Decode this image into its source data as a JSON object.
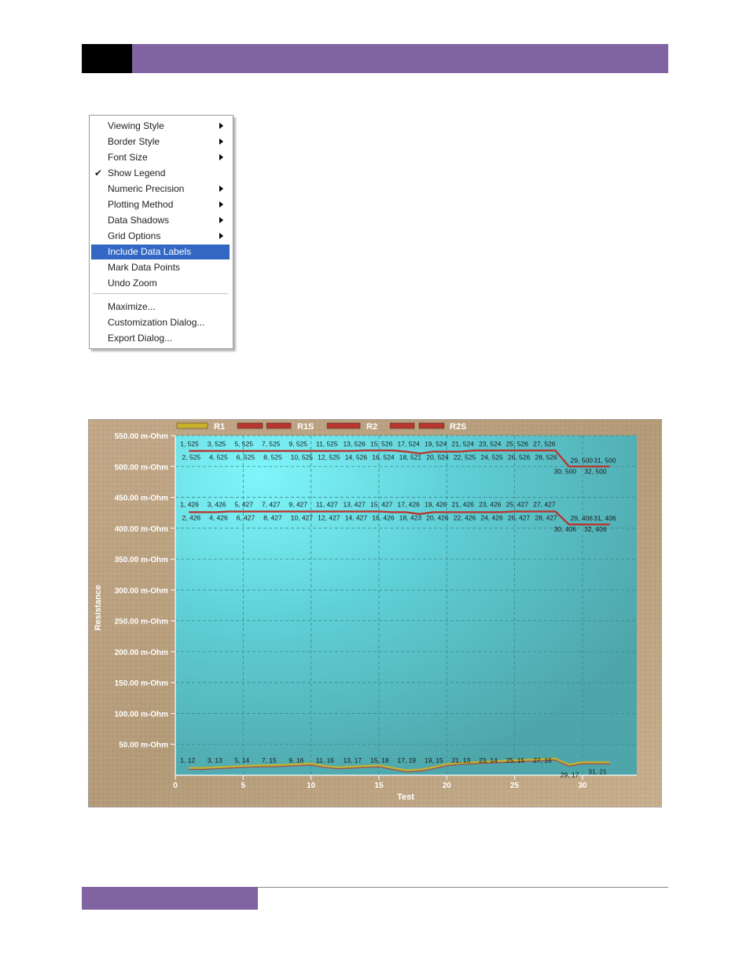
{
  "context_menu": {
    "items": [
      {
        "label": "Viewing Style",
        "submenu": true,
        "checked": false,
        "selected": false
      },
      {
        "label": "Border Style",
        "submenu": true,
        "checked": false,
        "selected": false
      },
      {
        "label": "Font Size",
        "submenu": true,
        "checked": false,
        "selected": false
      },
      {
        "label": "Show Legend",
        "submenu": false,
        "checked": true,
        "selected": false
      },
      {
        "label": "Numeric Precision",
        "submenu": true,
        "checked": false,
        "selected": false
      },
      {
        "label": "Plotting Method",
        "submenu": true,
        "checked": false,
        "selected": false
      },
      {
        "label": "Data Shadows",
        "submenu": true,
        "checked": false,
        "selected": false
      },
      {
        "label": "Grid Options",
        "submenu": true,
        "checked": false,
        "selected": false
      },
      {
        "label": "Include Data Labels",
        "submenu": false,
        "checked": false,
        "selected": true
      },
      {
        "label": "Mark Data Points",
        "submenu": false,
        "checked": false,
        "selected": false
      },
      {
        "label": "Undo Zoom",
        "submenu": false,
        "checked": false,
        "selected": false
      }
    ],
    "items2": [
      {
        "label": "Maximize..."
      },
      {
        "label": "Customization Dialog..."
      },
      {
        "label": "Export Dialog..."
      }
    ],
    "check_glyph": "✔"
  },
  "chart_data": {
    "type": "line",
    "xlabel": "Test",
    "ylabel": "Resistance",
    "xlim": [
      0,
      34
    ],
    "ylim": [
      0,
      550
    ],
    "xticks": [
      "0",
      "5",
      "10",
      "15",
      "20",
      "25",
      "30"
    ],
    "yticks": [
      "50.00 m-Ohm",
      "100.00 m-Ohm",
      "150.00 m-Ohm",
      "200.00 m-Ohm",
      "250.00 m-Ohm",
      "300.00 m-Ohm",
      "350.00 m-Ohm",
      "400.00 m-Ohm",
      "450.00 m-Ohm",
      "500.00 m-Ohm",
      "550.00 m-Ohm"
    ],
    "legend": [
      "R1",
      "R1S",
      "R2",
      "R2S"
    ],
    "colors": {
      "R1": "#c9b02a",
      "R1S": "#b9362e",
      "R2": "#b9362e",
      "R2S": "#b9362e",
      "low": "#c9b02a"
    },
    "series": [
      {
        "name": "R1S",
        "values": [
          525,
          525,
          525,
          525,
          525,
          525,
          525,
          525,
          525,
          525,
          525,
          525,
          525,
          526,
          526,
          526,
          524,
          521,
          524,
          524,
          524,
          526,
          526,
          526,
          526,
          526,
          526,
          526,
          500,
          500,
          500,
          500
        ]
      },
      {
        "name": "R2S",
        "values": [
          426,
          426,
          426,
          427,
          427,
          427,
          427,
          427,
          427,
          427,
          427,
          427,
          427,
          427,
          427,
          426,
          426,
          423,
          426,
          426,
          426,
          426,
          426,
          426,
          427,
          427,
          427,
          427,
          406,
          406,
          406,
          406
        ]
      },
      {
        "name": "R1",
        "values": [
          12,
          12,
          13,
          14,
          15,
          16,
          16,
          17,
          18,
          19,
          15,
          13,
          14,
          15,
          16,
          12,
          8,
          9,
          13,
          18,
          20,
          21,
          22,
          23,
          24,
          25,
          26,
          27,
          17,
          21,
          21,
          21
        ]
      }
    ],
    "top_labels_1": [
      "1, 525",
      "3, 525",
      "5, 525",
      "7, 525",
      "9, 525",
      "11, 525",
      "13, 526",
      "15, 526",
      "17, 524",
      "19, 524",
      "21, 524",
      "23, 524",
      "25, 526",
      "27, 526"
    ],
    "bottom_labels_1": [
      "2, 525",
      "4, 525",
      "6, 525",
      "8, 525",
      "10, 525",
      "12, 525",
      "14, 526",
      "16, 524",
      "18, 521",
      "20, 524",
      "22, 525",
      "24, 525",
      "26, 526",
      "28, 526"
    ],
    "end_labels_1": [
      "29, 500",
      "30, 500",
      "31, 500",
      "32, 500"
    ],
    "top_labels_2": [
      "1, 426",
      "3, 426",
      "5, 427",
      "7, 427",
      "9, 427",
      "11, 427",
      "13, 427",
      "15, 427",
      "17, 426",
      "19, 426",
      "21, 426",
      "23, 426",
      "25, 427",
      "27, 427"
    ],
    "bottom_labels_2": [
      "2, 426",
      "4, 426",
      "6, 427",
      "8, 427",
      "10, 427",
      "12, 427",
      "14, 427",
      "16, 426",
      "18, 423",
      "20, 426",
      "22, 426",
      "24, 426",
      "26, 427",
      "28, 427"
    ],
    "end_labels_2": [
      "29, 406",
      "30, 406",
      "31, 406",
      "32, 406"
    ],
    "low_labels": [
      "1, 12",
      "3, 13",
      "5, 14",
      "7, 15",
      "9, 16",
      "11, 16",
      "13, 17",
      "15, 18",
      "17, 19",
      "19, 15",
      "21, 13",
      "23, 14",
      "25, 15",
      "27, 16",
      "29, 17",
      "31, 21"
    ]
  }
}
